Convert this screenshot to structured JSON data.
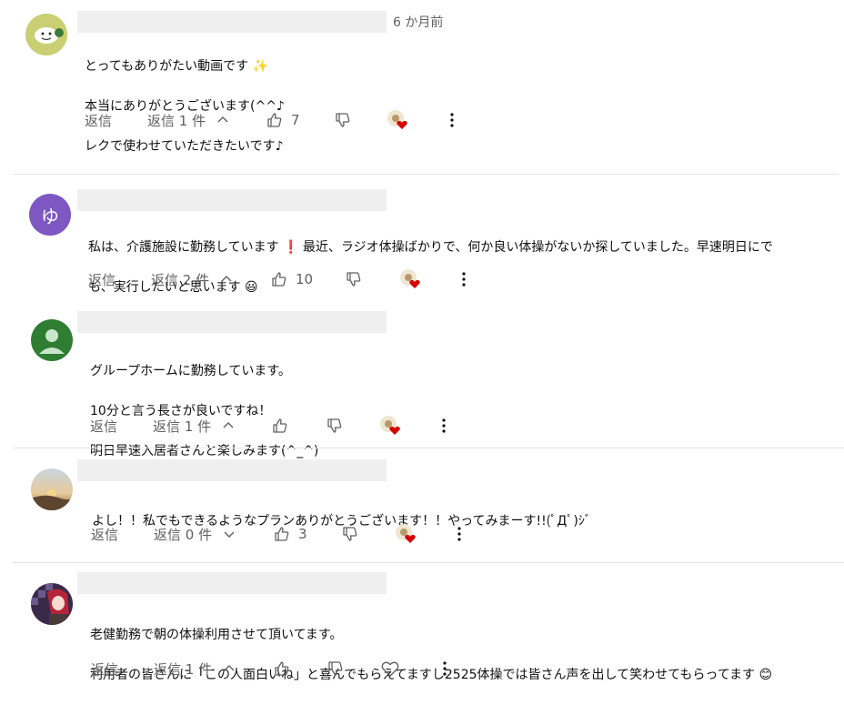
{
  "comments": [
    {
      "avatar": {
        "type": "image",
        "desc": "snowman"
      },
      "timestamp": "6 か月前",
      "lines": [
        "とってもありがたい動画です ✨",
        "本当にありがとうございます(^^♪",
        "レクで使わせていただきたいです♪"
      ],
      "reply_label": "返信",
      "replies_label": "返信 1 件",
      "likes": "7",
      "heart": "creator-heart"
    },
    {
      "avatar": {
        "type": "letter",
        "letter": "ゆ",
        "color": "#7e57c2"
      },
      "timestamp": "",
      "lines": [
        "私は、介護施設に勤務しています ❗ 最近、ラジオ体操ばかりで、何か良い体操がないか探していました。早速明日にで",
        "も、実行したいと思います 😃"
      ],
      "reply_label": "返信",
      "replies_label": "返信 2 件",
      "likes": "10",
      "heart": "creator-heart"
    },
    {
      "avatar": {
        "type": "default",
        "color": "#2e7d32"
      },
      "timestamp": "",
      "lines": [
        "グループホームに勤務しています。",
        "10分と言う長さが良いですね！",
        "明日早速入居者さんと楽しみます(^_^)"
      ],
      "reply_label": "返信",
      "replies_label": "返信 1 件",
      "likes": "",
      "heart": "creator-heart"
    },
    {
      "avatar": {
        "type": "image",
        "desc": "sunset"
      },
      "timestamp": "",
      "lines": [
        "よし！！私でもできるようなプランありがとうございます！！やってみまーす!!(ﾟДﾟ)ｼﾞ"
      ],
      "reply_label": "返信",
      "replies_label": "返信 0 件",
      "likes": "3",
      "heart": "creator-heart"
    },
    {
      "avatar": {
        "type": "image",
        "desc": "anime-character"
      },
      "timestamp": "",
      "lines": [
        "老健勤務で朝の体操利用させて頂いてます。",
        "利用者の皆さんに「この人面白いね」と喜んでもらえてますし2525体操では皆さん声を出して笑わせてもらってます 😊"
      ],
      "reply_label": "返信",
      "replies_label": "返信 1 件",
      "likes": "",
      "heart": "empty-heart"
    }
  ]
}
